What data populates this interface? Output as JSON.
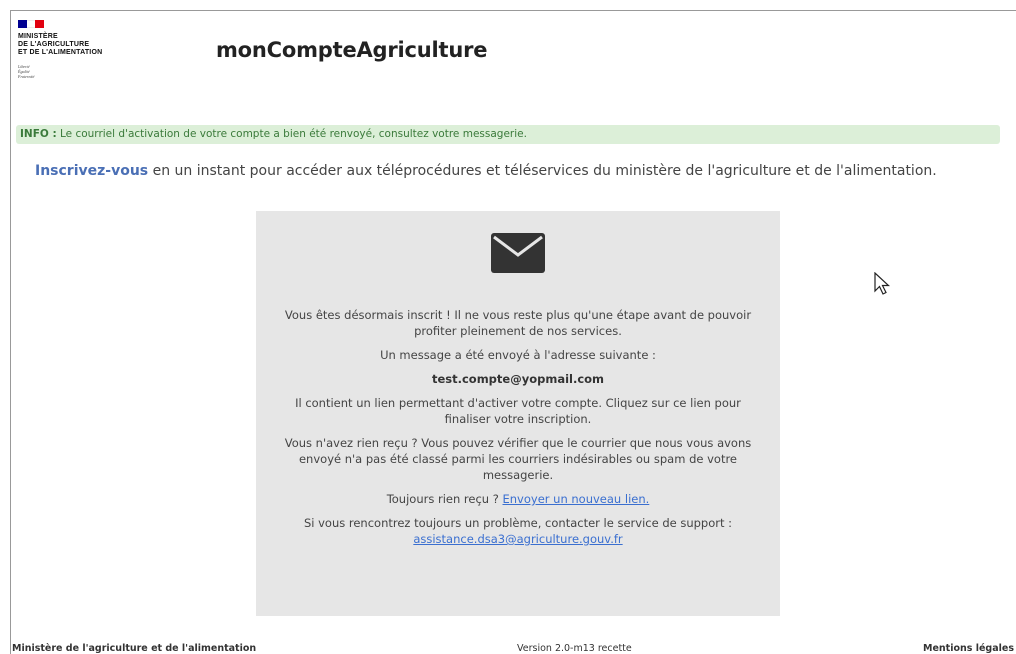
{
  "header": {
    "logo_text": "MINISTÈRE\nDE L'AGRICULTURE\nET DE L'ALIMENTATION",
    "motto": "Liberté\nÉgalité\nFraternité",
    "app_title": "monCompteAgriculture"
  },
  "info": {
    "label": "INFO :",
    "message": " Le courriel d'activation de votre compte a bien été renvoyé, consultez votre messagerie."
  },
  "intro": {
    "link": "Inscrivez-vous",
    "text": " en un instant pour accéder aux téléprocédures et téléservices du ministère de l'agriculture et de l'alimentation."
  },
  "card": {
    "icon": "envelope-icon",
    "p1": "Vous êtes désormais inscrit ! Il ne vous reste plus qu'une étape avant de pouvoir profiter pleinement de nos services.",
    "p2": "Un message a été envoyé à l'adresse suivante :",
    "email": "test.compte@yopmail.com",
    "p3": "Il contient un lien permettant d'activer votre compte. Cliquez sur ce lien pour finaliser votre inscription.",
    "p4": "Vous n'avez rien reçu ? Vous pouvez vérifier que le courrier que nous vous avons envoyé n'a pas été classé parmi les courriers indésirables ou spam de votre messagerie.",
    "p5_prefix": "Toujours rien reçu ? ",
    "p5_link": "Envoyer un nouveau lien.",
    "p6_prefix": "Si vous rencontrez toujours un problème, contacter le service de support : ",
    "p6_link": "assistance.dsa3@agriculture.gouv.fr"
  },
  "footer": {
    "left": "Ministère de l'agriculture et de l'alimentation",
    "center": "Version 2.0-m13 recette",
    "right": "Mentions légales"
  },
  "colors": {
    "info_bg": "#dcefd8",
    "info_text": "#3a7a3a",
    "link": "#4a6fb5",
    "card_bg": "#e6e6e6"
  }
}
